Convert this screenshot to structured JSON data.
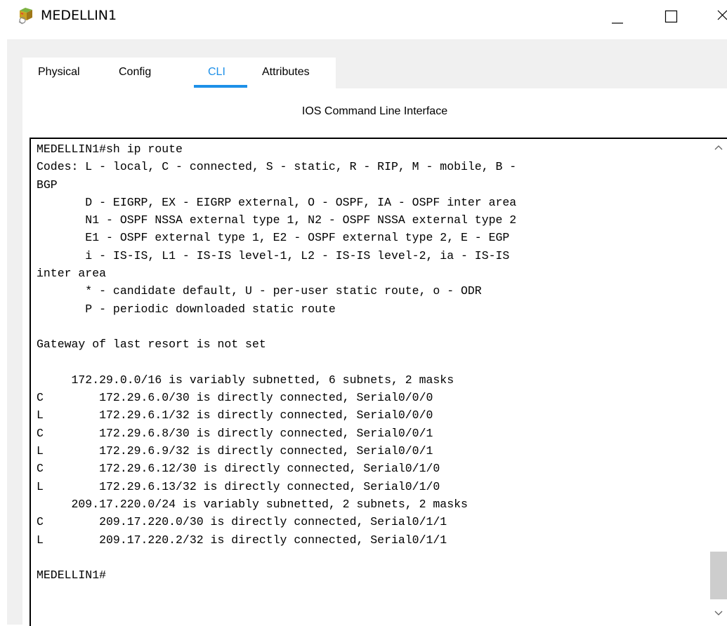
{
  "window": {
    "title": "MEDELLIN1",
    "icon": "router-icon"
  },
  "tabs": [
    {
      "label": "Physical"
    },
    {
      "label": "Config"
    },
    {
      "label": "CLI",
      "active": true
    },
    {
      "label": "Attributes"
    }
  ],
  "panel": {
    "title": "IOS Command Line Interface"
  },
  "terminal": {
    "lines": [
      "MEDELLIN1#sh ip route",
      "Codes: L - local, C - connected, S - static, R - RIP, M - mobile, B -",
      "BGP",
      "       D - EIGRP, EX - EIGRP external, O - OSPF, IA - OSPF inter area",
      "       N1 - OSPF NSSA external type 1, N2 - OSPF NSSA external type 2",
      "       E1 - OSPF external type 1, E2 - OSPF external type 2, E - EGP",
      "       i - IS-IS, L1 - IS-IS level-1, L2 - IS-IS level-2, ia - IS-IS",
      "inter area",
      "       * - candidate default, U - per-user static route, o - ODR",
      "       P - periodic downloaded static route",
      "",
      "Gateway of last resort is not set",
      "",
      "     172.29.0.0/16 is variably subnetted, 6 subnets, 2 masks",
      "C        172.29.6.0/30 is directly connected, Serial0/0/0",
      "L        172.29.6.1/32 is directly connected, Serial0/0/0",
      "C        172.29.6.8/30 is directly connected, Serial0/0/1",
      "L        172.29.6.9/32 is directly connected, Serial0/0/1",
      "C        172.29.6.12/30 is directly connected, Serial0/1/0",
      "L        172.29.6.13/32 is directly connected, Serial0/1/0",
      "     209.17.220.0/24 is variably subnetted, 2 subnets, 2 masks",
      "C        209.17.220.0/30 is directly connected, Serial0/1/1",
      "L        209.17.220.2/32 is directly connected, Serial0/1/1",
      "",
      "MEDELLIN1#"
    ]
  },
  "colors": {
    "accent": "#1e90e8",
    "client_bg": "#f0f0f0",
    "scroll_thumb": "#cdcdcd"
  }
}
